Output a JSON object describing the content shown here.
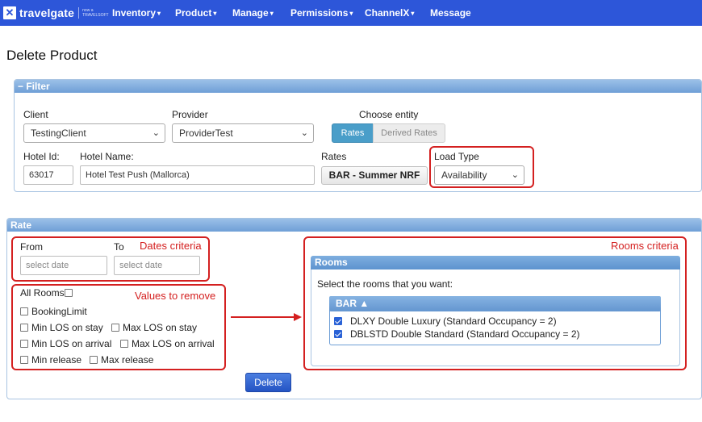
{
  "navbar": {
    "logo_text": "travelgate",
    "logo_sub": "now a TRAVELSOFT",
    "items": [
      {
        "label": "Inventory",
        "caret": "▾"
      },
      {
        "label": "Product",
        "caret": "▾"
      },
      {
        "label": "Manage",
        "caret": "▾"
      },
      {
        "label": "Permissions",
        "caret": "▾"
      },
      {
        "label": "ChannelX",
        "caret": "▾"
      },
      {
        "label": "Message",
        "caret": ""
      }
    ]
  },
  "page": {
    "title": "Delete Product"
  },
  "filter": {
    "header": "− Filter",
    "client_label": "Client",
    "client_value": "TestingClient",
    "provider_label": "Provider",
    "provider_value": "ProviderTest",
    "entity_label": "Choose entity",
    "entity_options": [
      "Rates",
      "Derived Rates"
    ],
    "entity_selected": "Rates",
    "hotel_id_label": "Hotel Id:",
    "hotel_id_value": "63017",
    "hotel_name_label": "Hotel Name:",
    "hotel_name_value": "Hotel Test Push (Mallorca)",
    "rates_label": "Rates",
    "rates_value": "BAR - Summer NRF",
    "load_type_label": "Load Type",
    "load_type_value": "Availability"
  },
  "rate": {
    "header": "Rate",
    "from_label": "From",
    "to_label": "To",
    "from_placeholder": "select date",
    "to_placeholder": "select date",
    "dates_annotation": "Dates criteria",
    "values_annotation": "Values to remove",
    "rooms_annotation": "Rooms criteria",
    "all_rooms_label": "All Rooms",
    "all_rooms_checked": false,
    "value_options": [
      {
        "label": "BookingLimit",
        "checked": false
      },
      {
        "label": "Min LOS on stay",
        "checked": false
      },
      {
        "label": "Max LOS on stay",
        "checked": false
      },
      {
        "label": "Min LOS on arrival",
        "checked": false
      },
      {
        "label": "Max LOS on arrival",
        "checked": false
      },
      {
        "label": "Min release",
        "checked": false
      },
      {
        "label": "Max release",
        "checked": false
      }
    ],
    "rooms": {
      "header": "Rooms",
      "instruction": "Select the rooms that you want:",
      "group_label": "BAR ▲",
      "items": [
        {
          "label": "DLXY Double Luxury (Standard Occupancy = 2)",
          "checked": true
        },
        {
          "label": "DBLSTD Double Standard (Standard Occupancy = 2)",
          "checked": true
        }
      ]
    },
    "delete_label": "Delete"
  },
  "colors": {
    "navbar": "#2d56d9",
    "annotation": "#d42020",
    "panel_header": "#7ea9dc"
  }
}
